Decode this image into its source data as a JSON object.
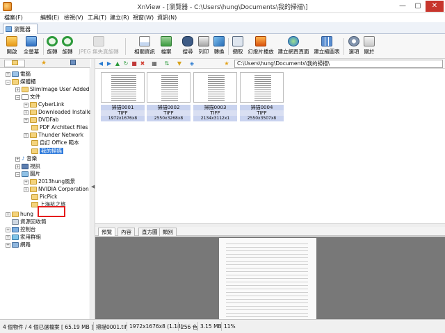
{
  "window": {
    "title": "XnView - [瀏覽器 - C:\\Users\\hung\\Documents\\我的掃描\\]",
    "min": "—",
    "max": "▢",
    "close": "✕"
  },
  "menu": [
    "檔案(F)",
    "編輯(E)",
    "檢視(V)",
    "工具(T)",
    "建立(R)",
    "視窗(W)",
    "資訊(N)"
  ],
  "tab": {
    "label": "瀏覽器"
  },
  "toolbar": {
    "buttons": [
      {
        "label": "開啟",
        "enabled": true
      },
      {
        "label": "全螢幕",
        "enabled": true
      },
      {
        "label": "旋轉",
        "enabled": true
      },
      {
        "label": "旋轉",
        "enabled": true
      },
      {
        "label": "JPEG 無失真旋轉",
        "enabled": false
      },
      {
        "label": "相關資訊",
        "enabled": true
      },
      {
        "label": "檔案",
        "enabled": true
      },
      {
        "label": "搜尋",
        "enabled": true
      },
      {
        "label": "列印",
        "enabled": true
      },
      {
        "label": "轉換",
        "enabled": true
      },
      {
        "label": "擷取",
        "enabled": true
      },
      {
        "label": "幻燈片播放",
        "enabled": true
      },
      {
        "label": "建立網頁頁面",
        "enabled": true
      },
      {
        "label": "建立縮圖表",
        "enabled": true
      },
      {
        "label": "選項",
        "enabled": true
      },
      {
        "label": "關於",
        "enabled": true
      }
    ]
  },
  "tree": {
    "items": [
      {
        "label": "電腦"
      },
      {
        "label": "媒體櫃"
      },
      {
        "label": "SlimImage User Added"
      },
      {
        "label": "文件"
      },
      {
        "label": "CyberLink"
      },
      {
        "label": "Downloaded Installe"
      },
      {
        "label": "DVDFab"
      },
      {
        "label": "PDF Architect Files"
      },
      {
        "label": "Thunder Network"
      },
      {
        "label": "自訂 Office 範本"
      },
      {
        "label": "我的掃描"
      },
      {
        "label": "音樂"
      },
      {
        "label": "視訊"
      },
      {
        "label": "圖片"
      },
      {
        "label": "2013hung風景"
      },
      {
        "label": "NVIDIA Corporation"
      },
      {
        "label": "PicPick"
      },
      {
        "label": "上海杭之旅"
      },
      {
        "label": "hung"
      },
      {
        "label": "資源回收筒"
      },
      {
        "label": "控制台"
      },
      {
        "label": "家用群組"
      },
      {
        "label": "網路"
      }
    ]
  },
  "address": {
    "path": "C:\\Users\\hung\\Documents\\我的掃描\\"
  },
  "thumbnails": [
    {
      "name": "掃描0001",
      "format": "TIFF",
      "dims": "1972x1676x8"
    },
    {
      "name": "掃描0002",
      "format": "TIFF",
      "dims": "2550x3268x8"
    },
    {
      "name": "掃描0003",
      "format": "TIFF",
      "dims": "2134x3112x1"
    },
    {
      "name": "掃描0004",
      "format": "TIFF",
      "dims": "2550x3507x8"
    }
  ],
  "preview_tabs": [
    "預覽",
    "內容",
    "直方圖",
    "類別"
  ],
  "status": {
    "count": "4 個物件 / 4 個已選檔案  [ 65.19 MB ]",
    "file": "掃描0001.tif",
    "dims": "1972x1676x8 (1.18)",
    "colors": "256 色",
    "size": "3.15 MB",
    "zoom": "11%"
  },
  "colors": {
    "selection": "#2f7bdc",
    "highlight_box": "#e51b1b",
    "caption_bg": "#c9d3ef"
  }
}
